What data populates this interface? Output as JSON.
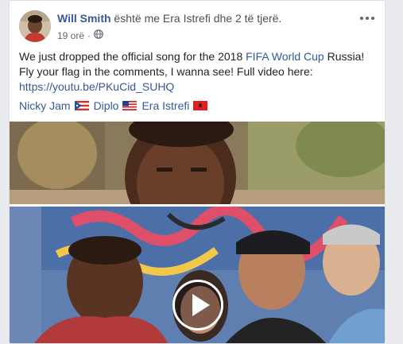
{
  "post": {
    "author": "Will Smith",
    "with_text": " është me Era Istrefi dhe 2 të tjerë.",
    "time": "19 orë",
    "separator": "·",
    "text_line1_pre": "We just dropped the official song for the 2018 ",
    "text_line1_link": "FIFA World Cup",
    "text_line1_post": " Russia!",
    "text_line2": "Fly your flag in the comments, I wanna see! Full video here:",
    "video_link": "https://youtu.be/PKuCid_SUHQ"
  },
  "tags": [
    {
      "name": "Nicky Jam",
      "flag_icon": "puerto-rico-flag-icon"
    },
    {
      "name": "Diplo",
      "flag_icon": "usa-flag-icon"
    },
    {
      "name": "Era Istrefi",
      "flag_icon": "albania-flag-icon"
    }
  ],
  "icons": {
    "more": "more-options-icon",
    "globe": "globe-icon",
    "play": "play-icon"
  },
  "colors": {
    "link": "#385898",
    "text": "#1d2129",
    "meta": "#616770",
    "background": "#e9ebee"
  }
}
